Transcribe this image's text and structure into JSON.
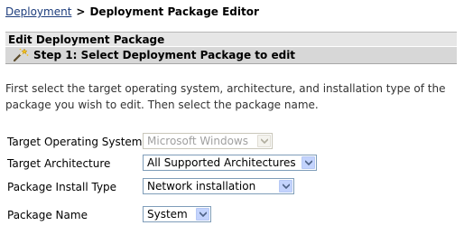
{
  "breadcrumb": {
    "link_label": "Deployment",
    "separator": ">",
    "current_label": "Deployment Package Editor"
  },
  "panel": {
    "title": "Edit Deployment Package",
    "step_label": "Step 1: Select Deployment Package to edit",
    "step_icon": "wand-icon"
  },
  "intro_text": "First select the target operating system, architecture, and installation type of the package you wish to edit. Then select the package name.",
  "form": {
    "os_label": "Target Operating System",
    "os_value": "Microsoft Windows",
    "arch_label": "Target Architecture",
    "arch_value": "All Supported Architectures",
    "install_label": "Package Install Type",
    "install_value": "Network installation",
    "name_label": "Package Name",
    "name_value": "System"
  },
  "colors": {
    "link": "#1c3c7c",
    "header_bg": "#e6e6e6",
    "step_bg": "#d7d7d7",
    "select_border": "#7f9db9",
    "arrow_bg": "#c3d3fd",
    "arrow_glyph": "#4d6185"
  }
}
